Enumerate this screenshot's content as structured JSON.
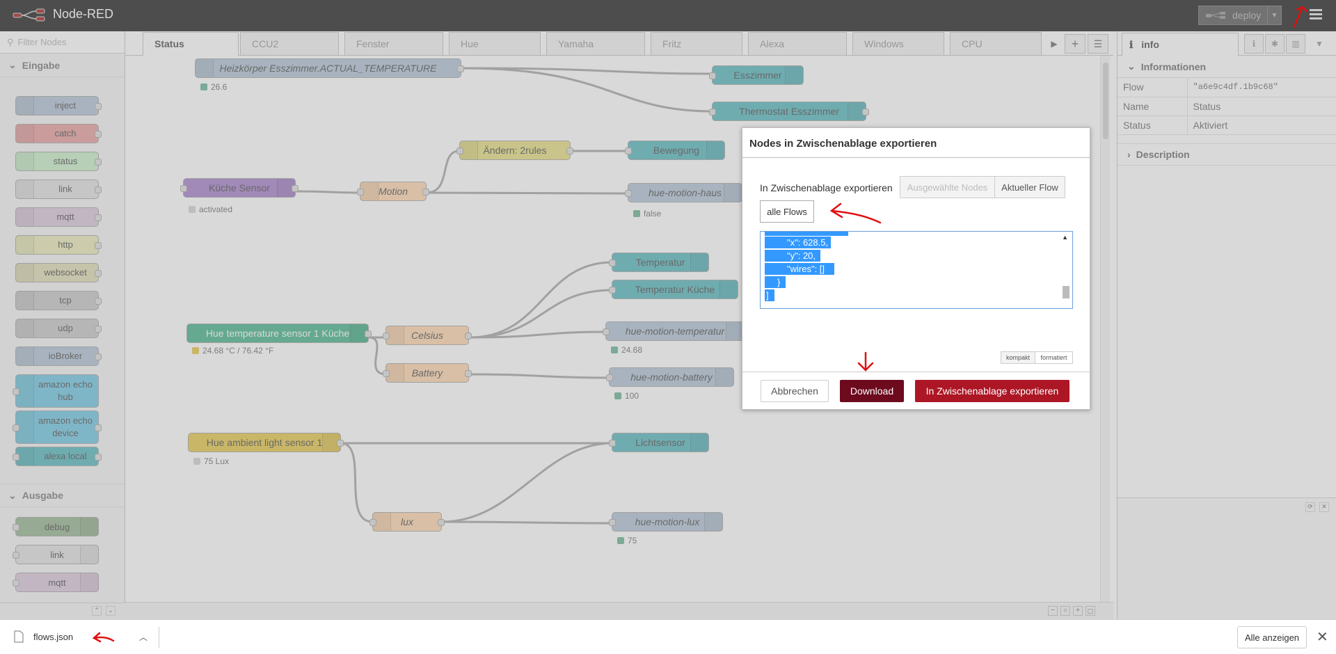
{
  "app": {
    "title": "Node-RED"
  },
  "header": {
    "deploy_label": "deploy"
  },
  "palette": {
    "filter_placeholder": "Filter Nodes",
    "categories": [
      {
        "label": "Eingabe"
      },
      {
        "label": "Ausgabe"
      }
    ],
    "input_nodes": [
      {
        "label": "inject",
        "color": "#a6bbcf"
      },
      {
        "label": "catch",
        "color": "#e49191"
      },
      {
        "label": "status",
        "color": "#c0edc0"
      },
      {
        "label": "link",
        "color": "#dddddd"
      },
      {
        "label": "mqtt",
        "color": "#d8bfd8"
      },
      {
        "label": "http",
        "color": "#e7e7ae"
      },
      {
        "label": "websocket",
        "color": "#dbd9a9"
      },
      {
        "label": "tcp",
        "color": "#c0c0c0"
      },
      {
        "label": "udp",
        "color": "#c0c0c0"
      },
      {
        "label": "ioBroker",
        "color": "#a6bbcf"
      },
      {
        "label": "amazon echo hub",
        "color": "#5bc0de"
      },
      {
        "label": "amazon echo device",
        "color": "#5bc0de"
      },
      {
        "label": "alexa local",
        "color": "#3fadb5"
      }
    ],
    "output_nodes": [
      {
        "label": "debug",
        "color": "#87a980"
      },
      {
        "label": "link",
        "color": "#dddddd"
      },
      {
        "label": "mqtt",
        "color": "#d8bfd8"
      }
    ]
  },
  "tabs": [
    "Status",
    "CCU2",
    "Fenster",
    "Hue",
    "Yamaha",
    "Fritz",
    "Alexa",
    "Windows",
    "CPU"
  ],
  "workspace": {
    "nodes": [
      {
        "label": "Heizkörper Esszimmer.ACTUAL_TEMPERATURE",
        "status": "26.6"
      },
      {
        "label": "Esszimmer"
      },
      {
        "label": "Thermostat Esszimmer"
      },
      {
        "label": "Ändern: 2rules"
      },
      {
        "label": "Bewegung"
      },
      {
        "label": "Küche Sensor",
        "status": "activated"
      },
      {
        "label": "Motion"
      },
      {
        "label": "hue-motion-haus",
        "status": "false"
      },
      {
        "label": "Temperatur"
      },
      {
        "label": "Temperatur Küche"
      },
      {
        "label": "Hue temperature sensor 1 Küche",
        "status": "24.68 °C / 76.42 °F"
      },
      {
        "label": "Celsius"
      },
      {
        "label": "hue-motion-temperatur",
        "status": "24.68"
      },
      {
        "label": "Battery"
      },
      {
        "label": "hue-motion-battery",
        "status": "100"
      },
      {
        "label": "Hue ambient light sensor 1",
        "status": "75 Lux"
      },
      {
        "label": "Lichtsensor"
      },
      {
        "label": "lux"
      },
      {
        "label": "hue-motion-lux",
        "status": "75"
      }
    ]
  },
  "sidebar": {
    "tab_label": "info",
    "section_info": "Informationen",
    "rows": [
      {
        "key": "Flow",
        "value": "\"a6e9c4df.1b9c68\""
      },
      {
        "key": "Name",
        "value": "Status"
      },
      {
        "key": "Status",
        "value": "Aktiviert"
      }
    ],
    "section_desc": "Description"
  },
  "dialog": {
    "title": "Nodes in Zwischenablage exportieren",
    "export_label": "In Zwischenablage exportieren",
    "option_selected_nodes": "Ausgewählte Nodes",
    "option_current_flow": "Aktueller Flow",
    "option_all_flows": "alle Flows",
    "json_lines": [
      "\"x\": 628.5,",
      "\"y\": 20,",
      "\"wires\": []",
      "}",
      "]"
    ],
    "format_compact": "kompakt",
    "format_formatted": "formatiert",
    "cancel_label": "Abbrechen",
    "download_label": "Download",
    "export_button_label": "In Zwischenablage exportieren"
  },
  "download_bar": {
    "filename": "flows.json",
    "show_all_label": "Alle anzeigen"
  },
  "colors": {
    "header_bg": "#000000",
    "download_btn": "#6e0a1e",
    "export_btn": "#ad1625",
    "selection": "#3399ff",
    "annotation": "#e01010"
  }
}
